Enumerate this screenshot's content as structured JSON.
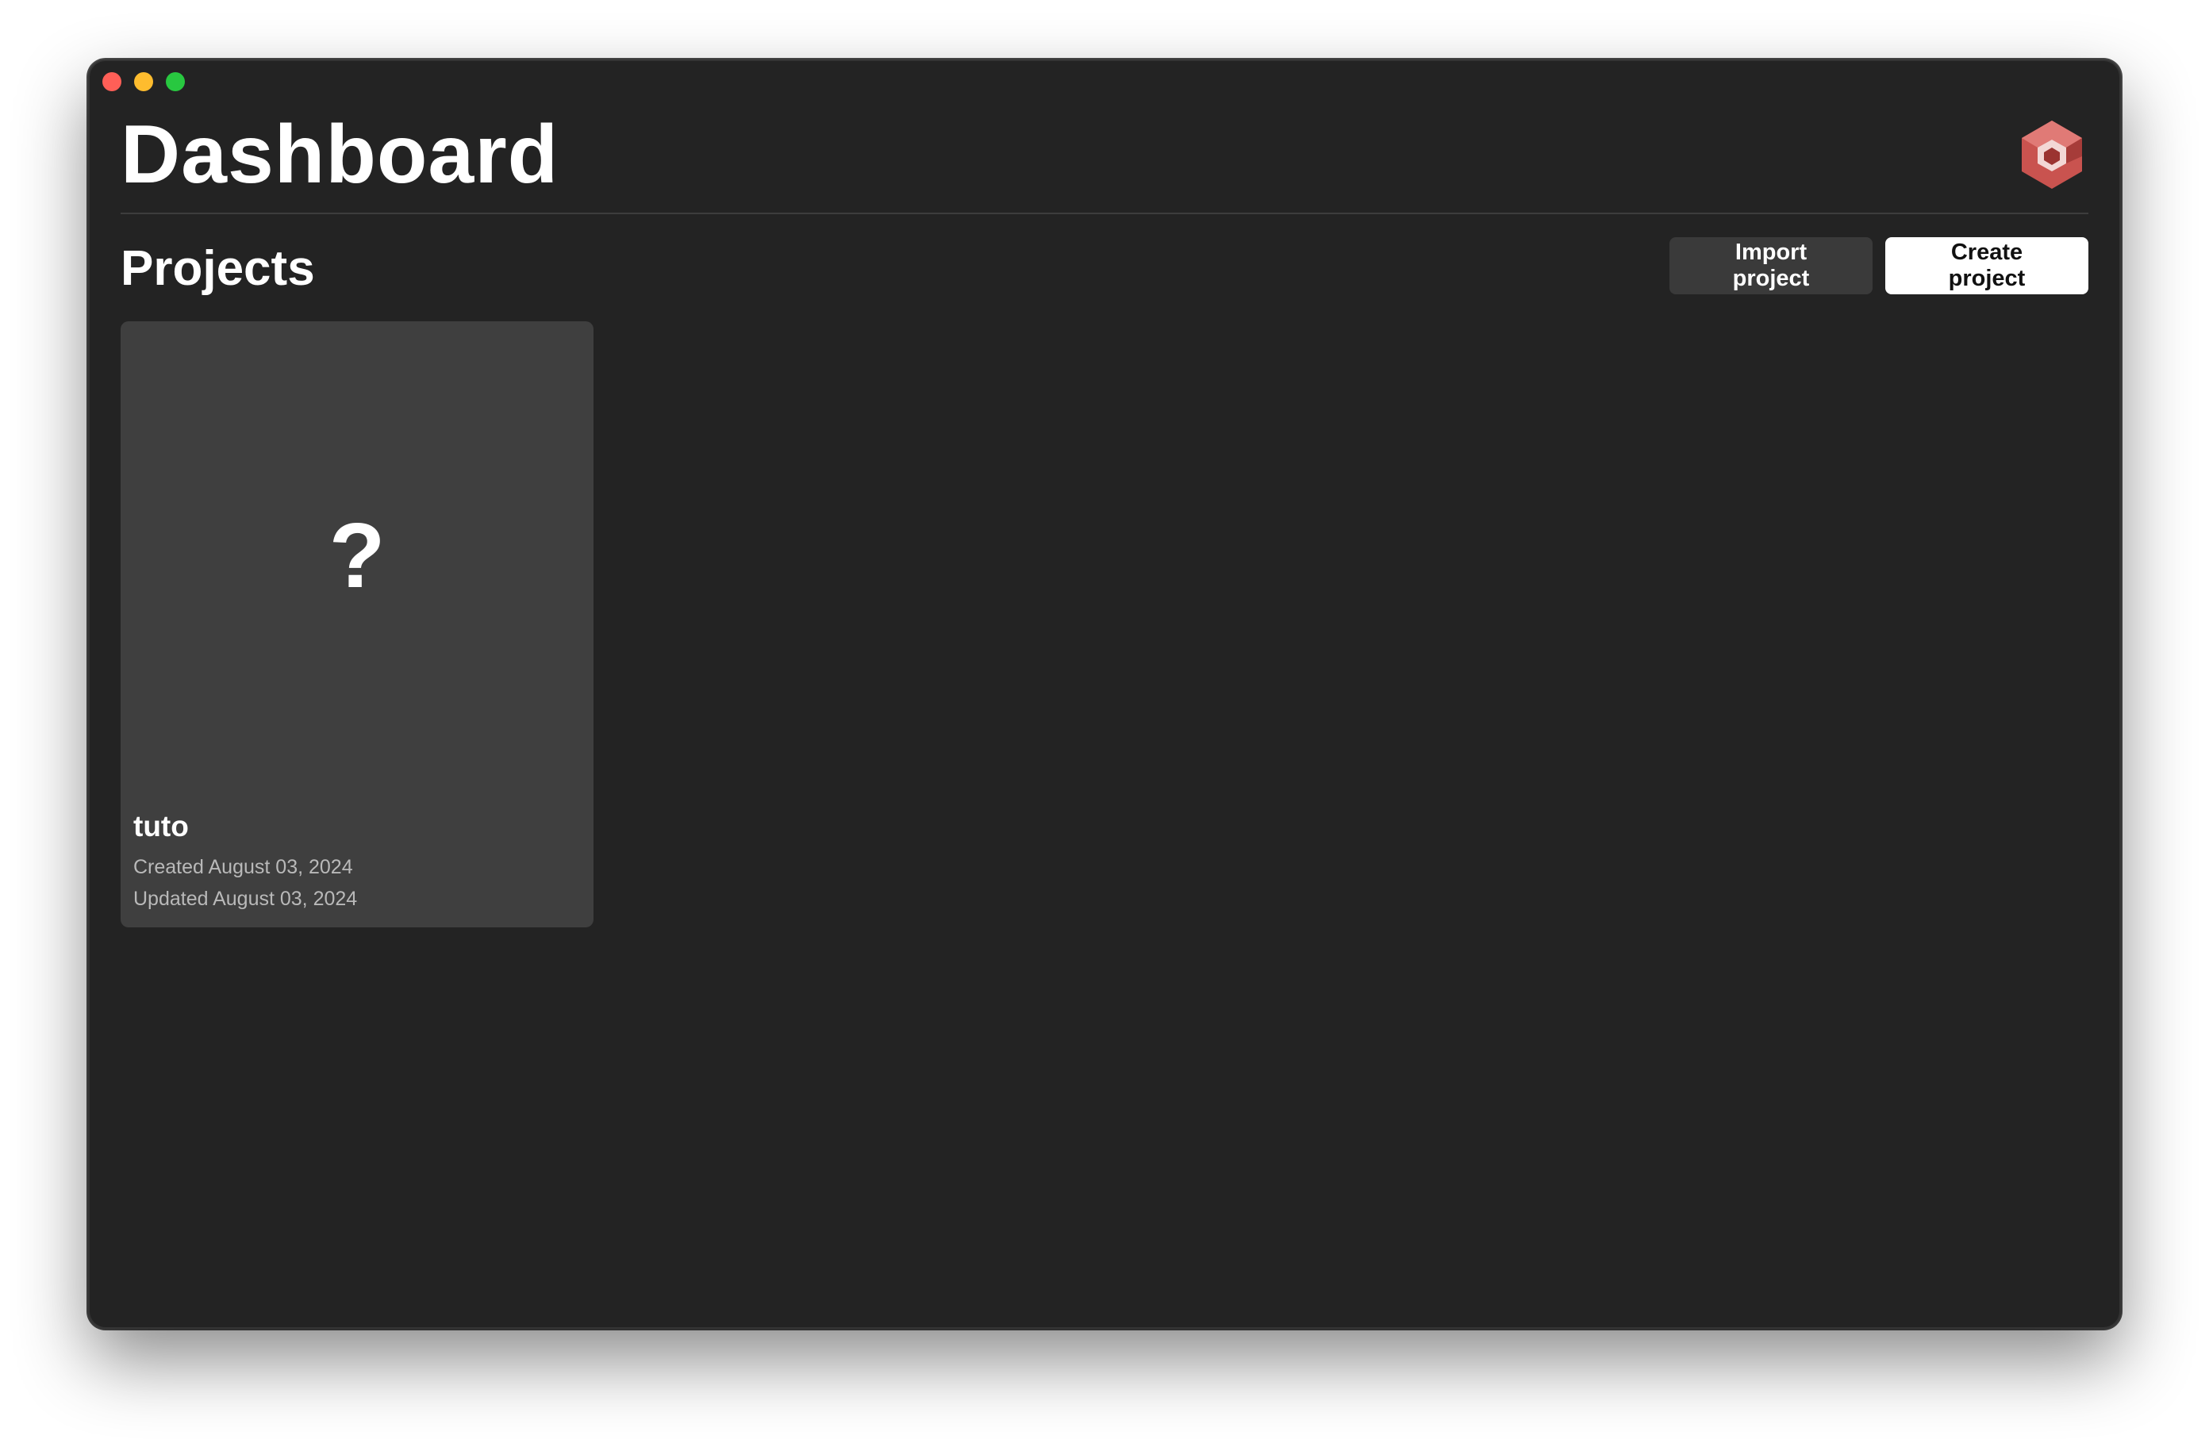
{
  "window": {
    "controls": [
      "close",
      "minimize",
      "zoom"
    ],
    "control_colors": {
      "close": "#ff5f57",
      "minimize": "#febc2e",
      "zoom": "#28c840"
    }
  },
  "header": {
    "title": "Dashboard",
    "logo_icon": "hexagon-cube-logo-icon",
    "logo_colors": {
      "primary": "#c9534f",
      "secondary": "#e88a86",
      "dark": "#8f2e2c"
    }
  },
  "projects": {
    "section_title": "Projects",
    "import_label": "Import project",
    "create_label": "Create project",
    "items": [
      {
        "name": "tuto",
        "thumbnail_icon": "question-mark-icon",
        "thumbnail_glyph": "?",
        "created": "Created August 03, 2024",
        "updated": "Updated August 03, 2024"
      }
    ]
  },
  "theme": {
    "background": "#232323",
    "card_background": "#3f3f3f",
    "secondary_button": "#3a3a3a",
    "primary_button": "#ffffff",
    "text": "#ffffff",
    "muted_text": "#b9b9b9"
  }
}
